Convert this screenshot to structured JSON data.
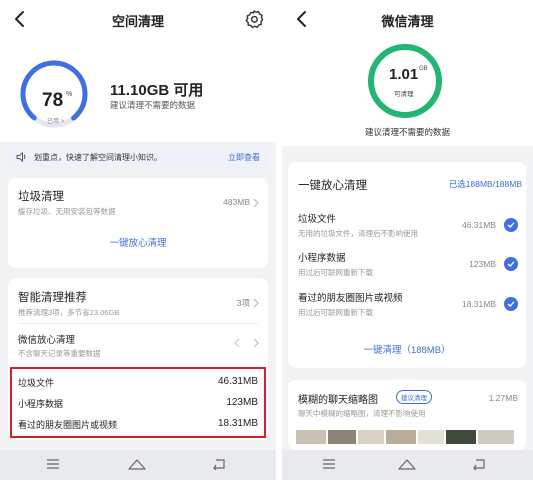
{
  "left": {
    "title": "空间清理",
    "usage_percent": "78",
    "percent_symbol": "%",
    "used_label": "已用 >",
    "available": "11.10GB 可用",
    "suggestion": "建议清理不需要的数据",
    "notice_text": "划重点，快速了解空间清理小知识。",
    "notice_link": "立即查看",
    "junk": {
      "title": "垃圾清理",
      "desc": "缓存垃圾、无用安装包等数据",
      "size": "483MB",
      "action": "一键放心清理"
    },
    "smart": {
      "title": "智能清理推荐",
      "desc": "推荐清理3项，多节省23.06GB",
      "count": "3项"
    },
    "wechat": {
      "title": "微信放心清理",
      "desc": "不含聊天记录等重要数据"
    },
    "highlight_rows": [
      {
        "label": "垃圾文件",
        "value": "46.31MB"
      },
      {
        "label": "小程序数据",
        "value": "123MB"
      },
      {
        "label": "看过的朋友圈图片或视频",
        "value": "18.31MB"
      }
    ]
  },
  "right": {
    "title": "微信清理",
    "size": "1.01",
    "unit": "GB",
    "size_caption": "可清理",
    "suggestion": "建议清理不需要的数据",
    "one_key": {
      "title": "一键放心清理",
      "selected": "已选188MB/188MB",
      "items": [
        {
          "title": "垃圾文件",
          "desc": "无用的垃圾文件，清理后不影响使用",
          "size": "46.31MB"
        },
        {
          "title": "小程序数据",
          "desc": "用过后可联网重新下载",
          "size": "123MB"
        },
        {
          "title": "看过的朋友圈图片或视频",
          "desc": "用过后可联网重新下载",
          "size": "18.31MB"
        }
      ],
      "action": "一键清理（188MB）"
    },
    "blurry": {
      "title": "模糊的聊天缩略图",
      "badge": "建议清理",
      "desc": "聊天中模糊的缩略图，清理不影响使用",
      "size": "1.27MB"
    }
  },
  "icons": {
    "back": "chevron-left-icon",
    "settings": "gear-icon",
    "speaker": "speaker-icon",
    "chevron": "chevron-right-icon",
    "check": "check-circle-icon",
    "menu": "menu-icon",
    "home": "home-icon",
    "return": "return-icon"
  },
  "colors": {
    "accent": "#3a6fd8",
    "ring_blue": "#3f6fe0",
    "ring_green": "#22b573",
    "highlight_border": "#d81e2c"
  }
}
